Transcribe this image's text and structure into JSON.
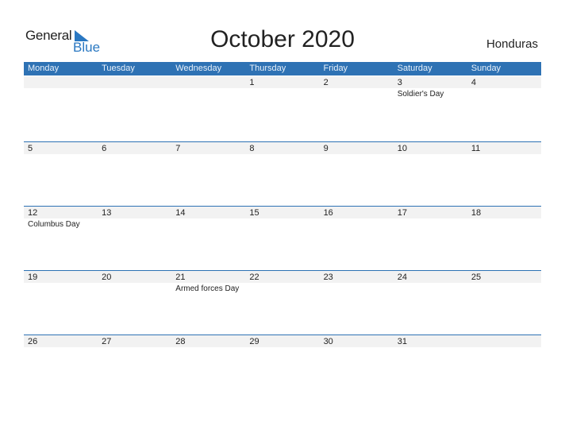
{
  "logo": {
    "line1": "General",
    "line2": "Blue",
    "icon": "triangle-flag-icon"
  },
  "title": "October 2020",
  "country": "Honduras",
  "colors": {
    "accent": "#2e72b4",
    "row_shade": "#f2f2f2",
    "logo_blue": "#2a78c2"
  },
  "weekdays": [
    "Monday",
    "Tuesday",
    "Wednesday",
    "Thursday",
    "Friday",
    "Saturday",
    "Sunday"
  ],
  "weeks": [
    {
      "days": [
        {
          "num": "",
          "holiday": ""
        },
        {
          "num": "",
          "holiday": ""
        },
        {
          "num": "",
          "holiday": ""
        },
        {
          "num": "1",
          "holiday": ""
        },
        {
          "num": "2",
          "holiday": ""
        },
        {
          "num": "3",
          "holiday": "Soldier's Day"
        },
        {
          "num": "4",
          "holiday": ""
        }
      ]
    },
    {
      "days": [
        {
          "num": "5",
          "holiday": ""
        },
        {
          "num": "6",
          "holiday": ""
        },
        {
          "num": "7",
          "holiday": ""
        },
        {
          "num": "8",
          "holiday": ""
        },
        {
          "num": "9",
          "holiday": ""
        },
        {
          "num": "10",
          "holiday": ""
        },
        {
          "num": "11",
          "holiday": ""
        }
      ]
    },
    {
      "days": [
        {
          "num": "12",
          "holiday": "Columbus Day"
        },
        {
          "num": "13",
          "holiday": ""
        },
        {
          "num": "14",
          "holiday": ""
        },
        {
          "num": "15",
          "holiday": ""
        },
        {
          "num": "16",
          "holiday": ""
        },
        {
          "num": "17",
          "holiday": ""
        },
        {
          "num": "18",
          "holiday": ""
        }
      ]
    },
    {
      "days": [
        {
          "num": "19",
          "holiday": ""
        },
        {
          "num": "20",
          "holiday": ""
        },
        {
          "num": "21",
          "holiday": "Armed forces Day"
        },
        {
          "num": "22",
          "holiday": ""
        },
        {
          "num": "23",
          "holiday": ""
        },
        {
          "num": "24",
          "holiday": ""
        },
        {
          "num": "25",
          "holiday": ""
        }
      ]
    },
    {
      "days": [
        {
          "num": "26",
          "holiday": ""
        },
        {
          "num": "27",
          "holiday": ""
        },
        {
          "num": "28",
          "holiday": ""
        },
        {
          "num": "29",
          "holiday": ""
        },
        {
          "num": "30",
          "holiday": ""
        },
        {
          "num": "31",
          "holiday": ""
        },
        {
          "num": "",
          "holiday": ""
        }
      ]
    }
  ]
}
